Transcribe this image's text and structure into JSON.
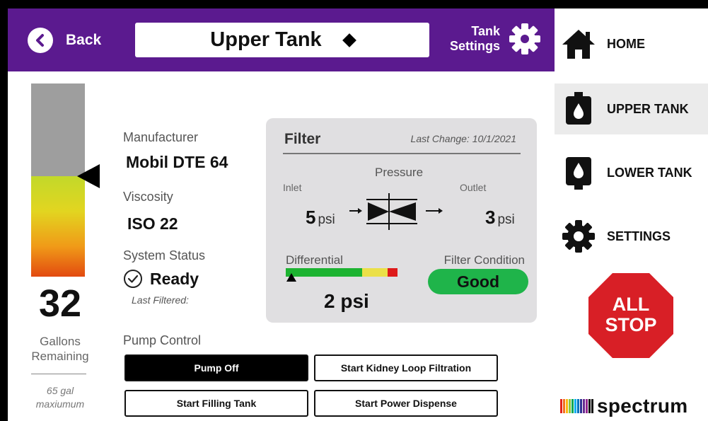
{
  "header": {
    "back_label": "Back",
    "tank_selector": "Upper Tank",
    "settings_line1": "Tank",
    "settings_line2": "Settings"
  },
  "sidebar": {
    "items": [
      {
        "label": "HOME",
        "icon": "home-icon",
        "active": false
      },
      {
        "label": "UPPER TANK",
        "icon": "tank-drop-icon",
        "active": true
      },
      {
        "label": "LOWER TANK",
        "icon": "tank-drop-icon",
        "active": false
      },
      {
        "label": "SETTINGS",
        "icon": "gear-icon",
        "active": false
      }
    ],
    "all_stop_line1": "ALL",
    "all_stop_line2": "STOP",
    "logo_text": "spectrum"
  },
  "level": {
    "value": "32",
    "label_line1": "Gallons",
    "label_line2": "Remaining",
    "max_line1": "65 gal",
    "max_line2": "maxiumum",
    "fill_fraction": 0.52
  },
  "info": {
    "manufacturer_label": "Manufacturer",
    "manufacturer_value": "Mobil DTE 64",
    "viscosity_label": "Viscosity",
    "viscosity_value": "ISO 22",
    "status_label": "System Status",
    "status_value": "Ready",
    "last_filtered_label": "Last Filtered:"
  },
  "filter": {
    "title": "Filter",
    "last_change": "Last Change: 10/1/2021",
    "pressure_label": "Pressure",
    "inlet_label": "Inlet",
    "outlet_label": "Outlet",
    "inlet_value": "5",
    "outlet_value": "3",
    "unit": "psi",
    "differential_label": "Differential",
    "differential_value": "2 psi",
    "condition_label": "Filter Condition",
    "condition_value": "Good"
  },
  "pump": {
    "label": "Pump Control",
    "buttons": [
      {
        "label": "Pump Off",
        "active": true
      },
      {
        "label": "Start Kidney Loop Filtration",
        "active": false
      },
      {
        "label": "Start Filling Tank",
        "active": false
      },
      {
        "label": "Start Power Dispense",
        "active": false
      }
    ]
  },
  "colors": {
    "header_purple": "#5b1a8f",
    "good_green": "#1fb44a",
    "stop_red": "#d81f26"
  }
}
